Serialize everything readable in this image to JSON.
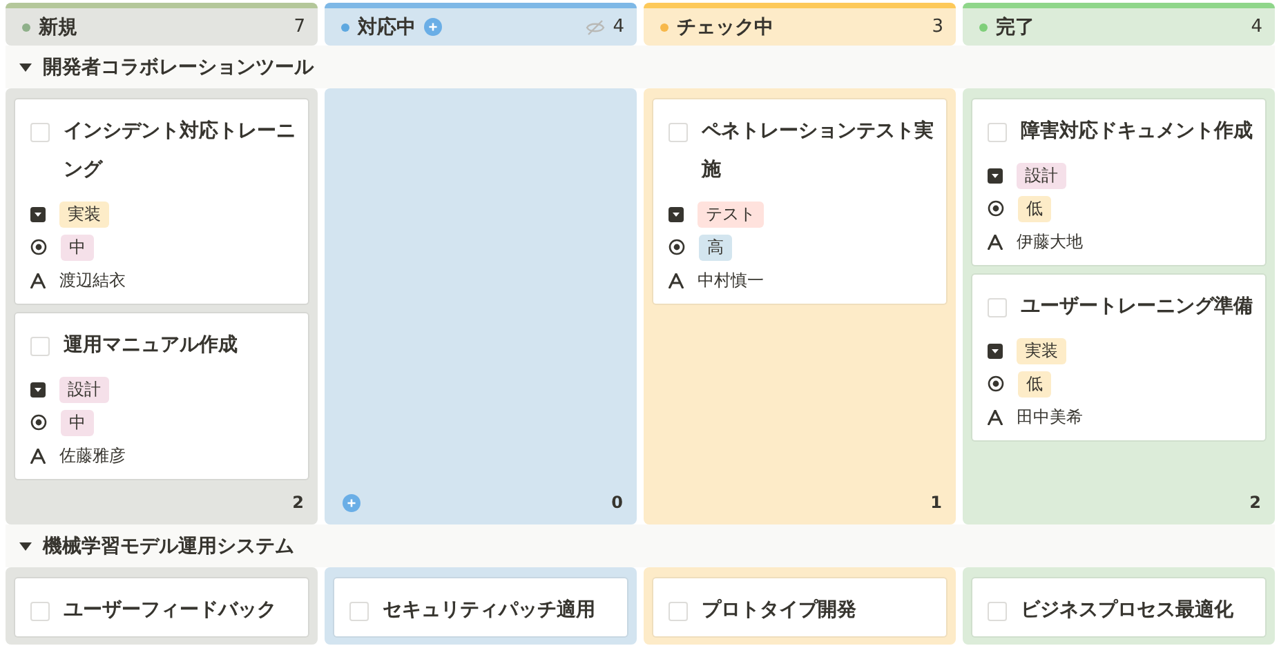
{
  "columns": [
    {
      "name": "新規",
      "color": "#8fb08a",
      "count": "7",
      "add": false,
      "hidden": false
    },
    {
      "name": "対応中",
      "color": "#5ea8e0",
      "count": "4",
      "add": true,
      "hidden": true
    },
    {
      "name": "チェック中",
      "color": "#f7b84a",
      "count": "3",
      "add": false,
      "hidden": false
    },
    {
      "name": "完了",
      "color": "#7fcf7a",
      "count": "4",
      "add": false,
      "hidden": false
    }
  ],
  "groups": [
    {
      "title": "開発者コラボレーションツール",
      "expanded": true,
      "lanes": [
        {
          "count": "2",
          "add": false,
          "cards": [
            {
              "title": "インシデント対応トレーニング",
              "checked": false,
              "type": {
                "label": "実装",
                "color": "#fdecc8"
              },
              "priority": {
                "label": "中",
                "color": "#f5e0e9"
              },
              "assignee": "渡辺結衣"
            },
            {
              "title": "運用マニュアル作成",
              "checked": false,
              "type": {
                "label": "設計",
                "color": "#f5e0e9"
              },
              "priority": {
                "label": "中",
                "color": "#f5e0e9"
              },
              "assignee": "佐藤雅彦"
            }
          ]
        },
        {
          "count": "0",
          "add": true
        },
        {
          "count": "1",
          "add": false,
          "cards": [
            {
              "title": "ペネトレーションテスト実施",
              "checked": false,
              "type": {
                "label": "テスト",
                "color": "#ffe2dd"
              },
              "priority": {
                "label": "高",
                "color": "#d3e5ef"
              },
              "assignee": "中村慎一"
            }
          ]
        },
        {
          "count": "2",
          "add": false,
          "cards": [
            {
              "title": "障害対応ドキュメント作成",
              "checked": false,
              "type": {
                "label": "設計",
                "color": "#f5e0e9"
              },
              "priority": {
                "label": "低",
                "color": "#fdecc8"
              },
              "assignee": "伊藤大地"
            },
            {
              "title": "ユーザートレーニング準備",
              "checked": false,
              "type": {
                "label": "実装",
                "color": "#fdecc8"
              },
              "priority": {
                "label": "低",
                "color": "#fdecc8"
              },
              "assignee": "田中美希"
            }
          ]
        }
      ]
    },
    {
      "title": "機械学習モデル運用システム",
      "expanded": true,
      "lanes": [
        {
          "cards": [
            {
              "title": "ユーザーフィードバック",
              "checked": false
            }
          ]
        },
        {
          "cards": [
            {
              "title": "セキュリティパッチ適用",
              "checked": false
            }
          ]
        },
        {
          "cards": [
            {
              "title": "プロトタイプ開発",
              "checked": false
            }
          ]
        },
        {
          "cards": [
            {
              "title": "ビジネスプロセス最適化",
              "checked": false
            }
          ]
        }
      ]
    }
  ]
}
